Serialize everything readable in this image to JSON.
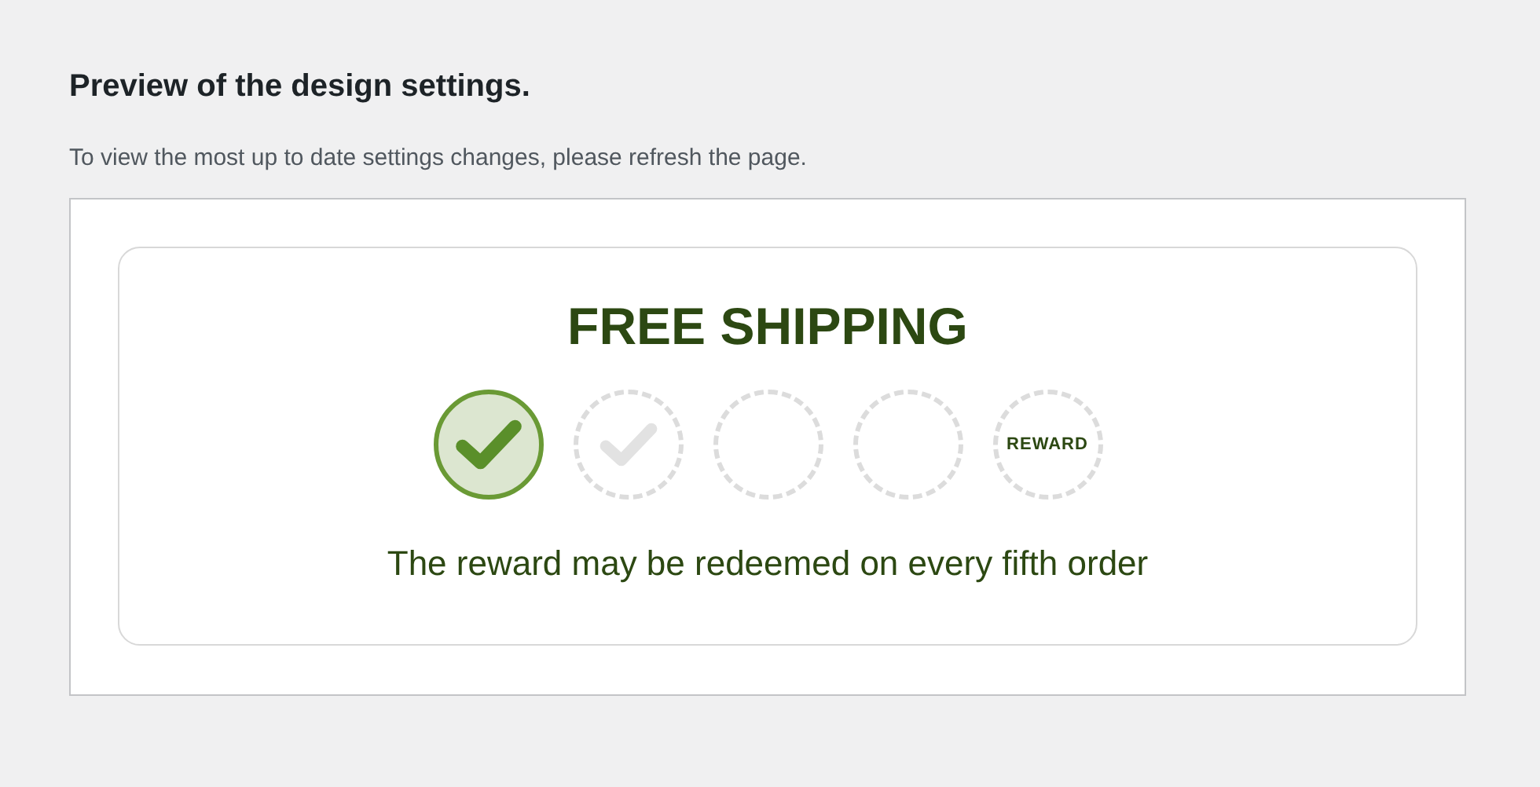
{
  "heading": "Preview of the design settings.",
  "description": "To view the most up to date settings changes, please refresh the page.",
  "card": {
    "title": "FREE SHIPPING",
    "stamps": [
      {
        "kind": "collected"
      },
      {
        "kind": "next"
      },
      {
        "kind": "empty"
      },
      {
        "kind": "empty"
      },
      {
        "kind": "reward",
        "label": "REWARD"
      }
    ],
    "message": "The reward may be redeemed on every fifth order"
  }
}
